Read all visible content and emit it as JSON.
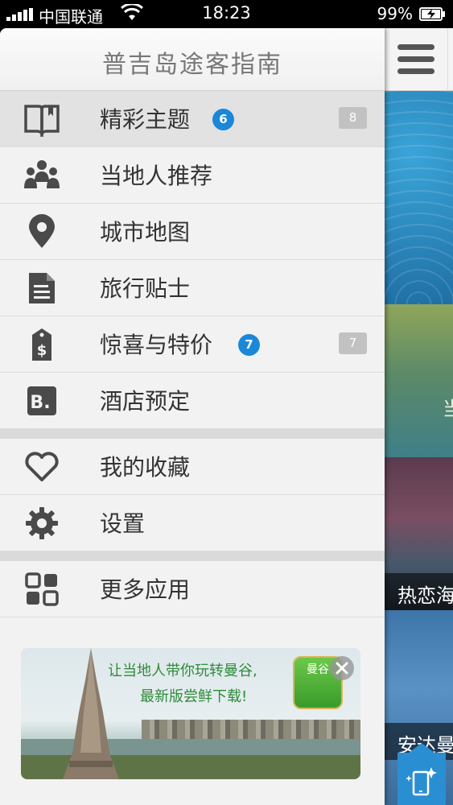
{
  "status_bar": {
    "carrier": "中国联通",
    "time": "18:23",
    "battery": "99%"
  },
  "drawer": {
    "title": "普吉岛途客指南",
    "items": [
      {
        "label": "精彩主题",
        "icon": "book-icon",
        "blue_badge": "6",
        "gray_badge": "8"
      },
      {
        "label": "当地人推荐",
        "icon": "people-icon"
      },
      {
        "label": "城市地图",
        "icon": "map-pin-icon"
      },
      {
        "label": "旅行贴士",
        "icon": "document-icon"
      },
      {
        "label": "惊喜与特价",
        "icon": "price-tag-icon",
        "blue_badge": "7",
        "gray_badge": "7"
      },
      {
        "label": "酒店预定",
        "icon": "booking-icon"
      },
      {
        "label": "我的收藏",
        "icon": "heart-icon"
      },
      {
        "label": "设置",
        "icon": "gear-icon"
      },
      {
        "label": "更多应用",
        "icon": "grid-apps-icon"
      }
    ],
    "banner": {
      "line1": "让当地人带你玩转曼谷,",
      "line2": "最新版尝鲜下载!",
      "app_icon_text": "曼谷"
    }
  },
  "background_panel": {
    "captions": [
      "当",
      "热恋海",
      "安达曼"
    ]
  },
  "colors": {
    "badge_blue": "#1a88d8",
    "badge_gray": "#c2c2c2",
    "drawer_bg": "#f2f2f2",
    "icon_dark": "#4a4a4a"
  }
}
